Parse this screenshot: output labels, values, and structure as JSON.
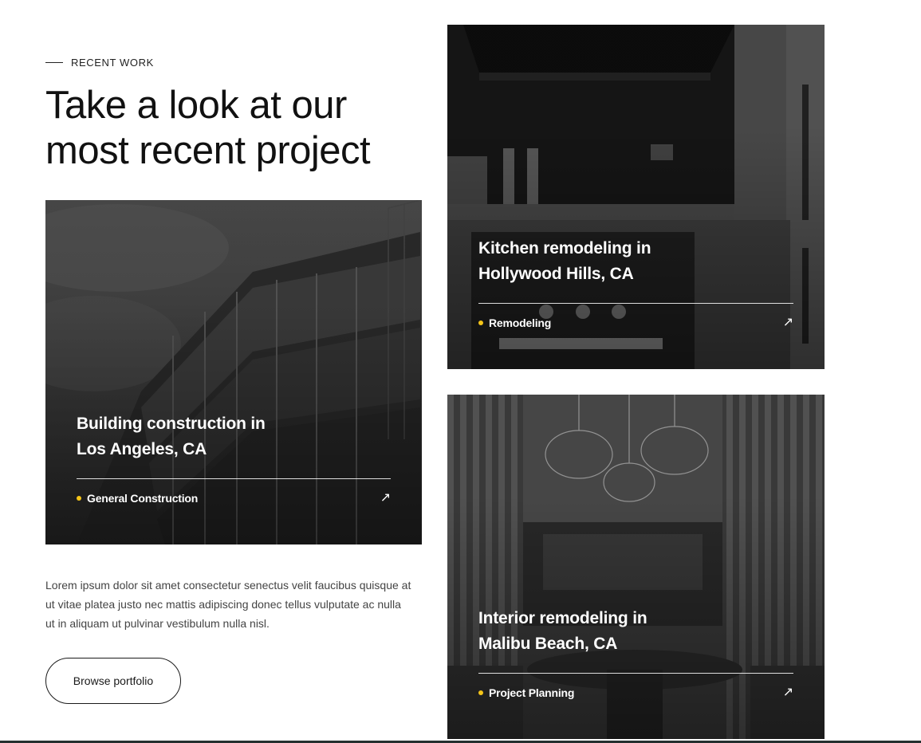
{
  "section": {
    "eyebrow": "RECENT WORK",
    "headline": "Take a look at our most recent project",
    "description": "Lorem ipsum dolor sit amet consectetur senectus velit faucibus quisque at ut vitae platea justo nec mattis adipiscing donec tellus vulputate ac nulla ut in aliquam ut pulvinar vestibulum nulla nisl.",
    "button_label": "Browse portfolio"
  },
  "projects": [
    {
      "title_line1": "Building construction in",
      "title_line2": "Los Angeles, CA",
      "category": "General Construction",
      "icon": "arrow-up-right-icon"
    },
    {
      "title_line1": "Kitchen remodeling in",
      "title_line2": "Hollywood Hills, CA",
      "category": "Remodeling",
      "icon": "arrow-up-right-icon"
    },
    {
      "title_line1": "Interior remodeling in",
      "title_line2": "Malibu Beach, CA",
      "category": "Project Planning",
      "icon": "arrow-up-right-icon"
    }
  ],
  "colors": {
    "accent_dot": "#f5c518",
    "text": "#111111",
    "bottom_bar": "#253130"
  }
}
